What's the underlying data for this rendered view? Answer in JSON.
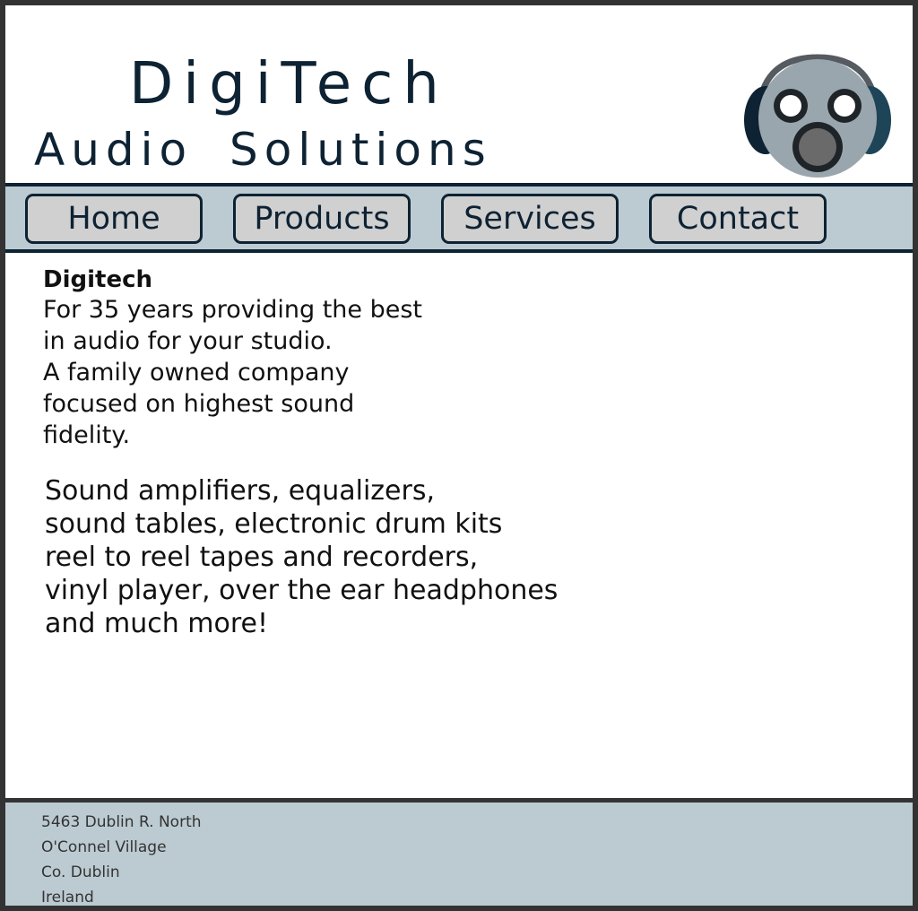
{
  "header": {
    "title": "DigiTech",
    "subtitle": "Audio Solutions",
    "logo_icon": "headphones-face-icon"
  },
  "nav": {
    "items": [
      {
        "label": "Home"
      },
      {
        "label": "Products"
      },
      {
        "label": "Services"
      },
      {
        "label": "Contact"
      }
    ]
  },
  "intro": {
    "heading": "Digitech",
    "lines": [
      "For 35 years providing the best",
      "in audio for your studio.",
      "A family owned company",
      "focused on highest sound",
      "fidelity."
    ]
  },
  "products": {
    "lines": [
      "Sound amplifiers, equalizers,",
      "sound tables, electronic drum kits",
      "reel to reel tapes and recorders,",
      "vinyl player, over the ear headphones",
      "and much more!"
    ]
  },
  "footer": {
    "address_lines": [
      "5463 Dublin R. North",
      "O'Connel Village",
      "Co. Dublin",
      "Ireland"
    ]
  },
  "colors": {
    "nav_background": "#bccbd2",
    "button_background": "#d0d0d0",
    "text_dark": "#0d2233",
    "frame_border": "#333333"
  }
}
